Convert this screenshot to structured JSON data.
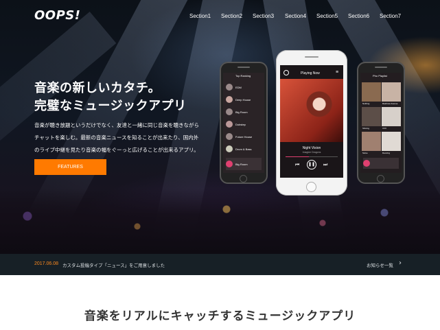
{
  "header": {
    "logo": "OOPS!",
    "nav": [
      "Section1",
      "Section2",
      "Section3",
      "Section4",
      "Section5",
      "Section6",
      "Section7"
    ]
  },
  "hero": {
    "headline_line1": "音楽の新しいカタチ。",
    "headline_line2": "完璧なミュージックアプリ",
    "desc_line1": "音楽が聴き放題というだけでなく、友達と一緒に同じ音楽を聴きながら",
    "desc_line2": "チャットを楽しむ。最新の音楽ニュースを知ることが出来たり、国内外",
    "desc_line3": "のライブ中継を見たり音楽の幅をぐーっと広げることが出来るアプリ。",
    "button_label": "FEATURES"
  },
  "phones": {
    "left": {
      "title": "Top Ranking",
      "items": [
        "EDM",
        "Deep House",
        "Big Room",
        "Dubstep",
        "Future House",
        "Drum & Bass",
        "Big Room"
      ]
    },
    "center": {
      "title": "Playing Now",
      "track": "Night Vision",
      "artist": "Imagine Dragons"
    },
    "right": {
      "title": "Pho Playlist",
      "items": [
        "Nothing",
        "Rainbow Avenue",
        "Shining",
        "XXX",
        "Solve",
        "Dancing"
      ]
    }
  },
  "news": {
    "date": "2017.06.08",
    "text": "カスタム投稿タイプ「ニュース」をご用意しました",
    "list_label": "お知らせ一覧"
  },
  "section": {
    "title": "音楽をリアルにキャッチするミュージックアプリ"
  },
  "colors": {
    "accent": "#ff7a00",
    "news_bar": "#172026",
    "news_date": "#ff8a1f"
  }
}
